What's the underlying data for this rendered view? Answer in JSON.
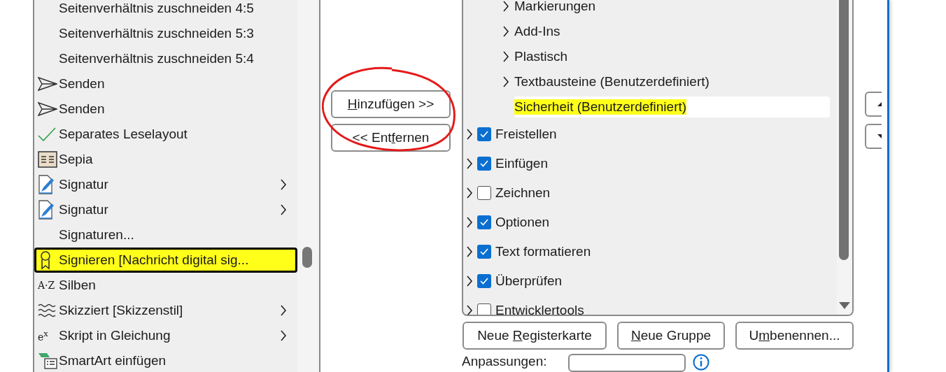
{
  "command_list": {
    "items": [
      {
        "label": "Seitenverhältnis zuschneiden 4:5",
        "kind": "plain",
        "submenu": false,
        "selected": false,
        "highlighted": false
      },
      {
        "label": "Seitenverhältnis zuschneiden 5:3",
        "kind": "plain",
        "submenu": false,
        "selected": false,
        "highlighted": false
      },
      {
        "label": "Seitenverhältnis zuschneiden 5:4",
        "kind": "plain",
        "submenu": false,
        "selected": false,
        "highlighted": false
      },
      {
        "label": "Senden",
        "kind": "send",
        "submenu": false,
        "selected": false,
        "highlighted": false
      },
      {
        "label": "Senden",
        "kind": "send",
        "submenu": false,
        "selected": false,
        "highlighted": false
      },
      {
        "label": "Separates Leselayout",
        "kind": "check",
        "submenu": false,
        "selected": false,
        "highlighted": false
      },
      {
        "label": "Sepia",
        "kind": "sepia",
        "submenu": false,
        "selected": false,
        "highlighted": false
      },
      {
        "label": "Signatur",
        "kind": "signature",
        "submenu": true,
        "selected": false,
        "highlighted": false
      },
      {
        "label": "Signatur",
        "kind": "signature",
        "submenu": true,
        "selected": false,
        "highlighted": false
      },
      {
        "label": "Signaturen...",
        "kind": "plain",
        "submenu": false,
        "selected": false,
        "highlighted": false
      },
      {
        "label": "Signieren [Nachricht digital sig...",
        "kind": "ribbon",
        "submenu": false,
        "selected": true,
        "highlighted": true
      },
      {
        "label": "Silben",
        "kind": "glyph",
        "glyph": "A·Z",
        "submenu": false,
        "selected": false,
        "highlighted": false
      },
      {
        "label": "Skizziert [Skizzenstil]",
        "kind": "sketch",
        "submenu": true,
        "selected": false,
        "highlighted": false
      },
      {
        "label": "Skript in Gleichung",
        "kind": "glyph",
        "glyph": "e$^{x}$",
        "submenu": true,
        "selected": false,
        "highlighted": false
      },
      {
        "label": "SmartArt einfügen",
        "kind": "smartart",
        "submenu": false,
        "selected": false,
        "highlighted": false
      }
    ]
  },
  "transfer_buttons": [
    {
      "key": "H",
      "after": "inzufügen >>",
      "circled": true
    },
    {
      "before": "<< Ent",
      "key": "f",
      "after": "ernen",
      "circled": false
    }
  ],
  "ribbon_tree": {
    "groups": [
      {
        "label": "Markierungen",
        "expandable": true,
        "selected": false,
        "highlighted": false
      },
      {
        "label": "Add-Ins",
        "expandable": true,
        "selected": false,
        "highlighted": false
      },
      {
        "label": "Plastisch",
        "expandable": true,
        "selected": false,
        "highlighted": false
      },
      {
        "label": "Textbausteine (Benutzerdefiniert)",
        "expandable": true,
        "selected": false,
        "highlighted": false
      },
      {
        "label": "Sicherheit (Benutzerdefiniert)",
        "expandable": false,
        "selected": true,
        "highlighted": true
      }
    ],
    "tabs": [
      {
        "label": "Freistellen",
        "checked": true
      },
      {
        "label": "Einfügen",
        "checked": true
      },
      {
        "label": "Zeichnen",
        "checked": false
      },
      {
        "label": "Optionen",
        "checked": true
      },
      {
        "label": "Text formatieren",
        "checked": true
      },
      {
        "label": "Überprüfen",
        "checked": true
      },
      {
        "label": "Entwicklertools",
        "checked": false
      }
    ]
  },
  "tree_buttons": [
    {
      "before": "Neue ",
      "key": "R",
      "after": "egisterkarte"
    },
    {
      "key": "N",
      "after": "eue Gruppe"
    },
    {
      "before": "U",
      "key": "m",
      "after": "benennen..."
    }
  ],
  "customizations": {
    "label": "Anpassungen:"
  }
}
